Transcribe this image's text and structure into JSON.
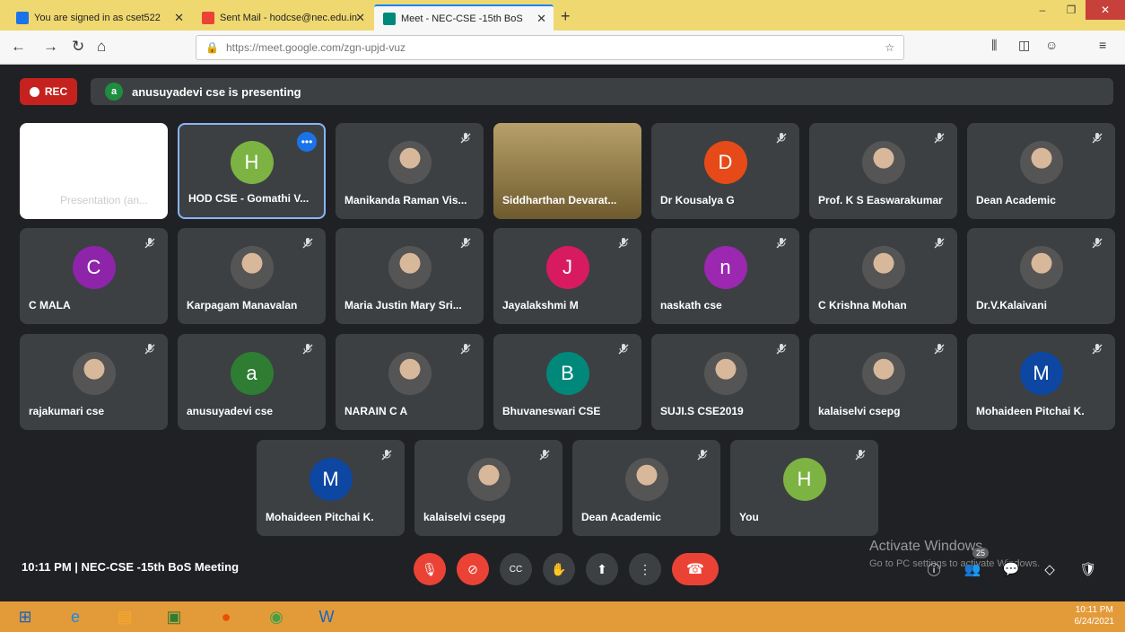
{
  "browser": {
    "tabs": [
      {
        "label": "You are signed in as cset522",
        "favicon_color": "#1a73e8",
        "active": false
      },
      {
        "label": "Sent Mail - hodcse@nec.edu.in",
        "favicon_color": "#ea4335",
        "active": false
      },
      {
        "label": "Meet - NEC-CSE -15th BoS",
        "favicon_color": "#00897b",
        "active": true
      }
    ],
    "new_tab": "+",
    "url": "https://meet.google.com/zgn-upjd-vuz",
    "window_controls": {
      "minimize": "–",
      "maximize": "❐",
      "close": "✕"
    }
  },
  "meet": {
    "rec_label": "REC",
    "presenting": {
      "avatar_letter": "a",
      "text": "anusuyadevi cse is presenting"
    },
    "tiles": [
      {
        "name": "Presentation (an...",
        "type": "slide"
      },
      {
        "name": "HOD CSE - Gomathi V...",
        "type": "letter",
        "letter": "H",
        "color": "#7cb342",
        "highlight": true
      },
      {
        "name": "Manikanda Raman Vis...",
        "type": "photo"
      },
      {
        "name": "Siddharthan Devarat...",
        "type": "video"
      },
      {
        "name": "Dr Kousalya G",
        "type": "letter",
        "letter": "D",
        "color": "#e64a19"
      },
      {
        "name": "Prof. K S Easwarakumar",
        "type": "photo"
      },
      {
        "name": "Dean Academic",
        "type": "photo"
      },
      {
        "name": "C MALA",
        "type": "letter",
        "letter": "C",
        "color": "#8e24aa"
      },
      {
        "name": "Karpagam Manavalan",
        "type": "photo"
      },
      {
        "name": "Maria Justin Mary Sri...",
        "type": "photo"
      },
      {
        "name": "Jayalakshmi M",
        "type": "letter",
        "letter": "J",
        "color": "#d81b60"
      },
      {
        "name": "naskath cse",
        "type": "letter",
        "letter": "n",
        "color": "#9c27b0"
      },
      {
        "name": "C Krishna Mohan",
        "type": "photo"
      },
      {
        "name": "Dr.V.Kalaivani",
        "type": "photo"
      },
      {
        "name": "rajakumari cse",
        "type": "photo"
      },
      {
        "name": "anusuyadevi cse",
        "type": "letter",
        "letter": "a",
        "color": "#2e7d32"
      },
      {
        "name": "NARAIN C A",
        "type": "photo"
      },
      {
        "name": "Bhuvaneswari CSE",
        "type": "letter",
        "letter": "B",
        "color": "#00897b"
      },
      {
        "name": "SUJI.S CSE2019",
        "type": "photo"
      },
      {
        "name": "kalaiselvi csepg",
        "type": "photo"
      },
      {
        "name": "Mohaideen Pitchai K.",
        "type": "letter",
        "letter": "M",
        "color": "#0d47a1"
      },
      {
        "name": "Mohaideen Pitchai K.",
        "type": "letter",
        "letter": "M",
        "color": "#0d47a1"
      },
      {
        "name": "kalaiselvi csepg",
        "type": "photo"
      },
      {
        "name": "Dean Academic",
        "type": "photo"
      },
      {
        "name": "You",
        "type": "letter",
        "letter": "H",
        "color": "#7cb342"
      }
    ],
    "meeting_info": "10:11 PM  |  NEC-CSE -15th BoS Meeting",
    "controls": {
      "mic": "🎤",
      "camera": "📷",
      "captions": "CC",
      "hand": "✋",
      "present": "⬆",
      "more": "⋮",
      "hangup": "☎"
    },
    "watermark_title": "Activate Windows",
    "watermark_sub": "Go to PC settings to activate Windows.",
    "participants_count": "25"
  },
  "taskbar": {
    "time": "10:11 PM",
    "date": "6/24/2021"
  }
}
